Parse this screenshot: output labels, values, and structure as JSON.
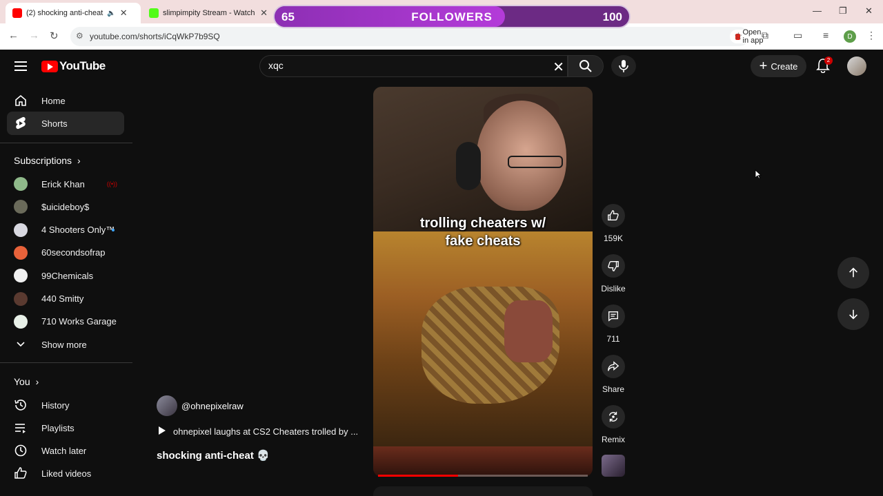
{
  "browser": {
    "tabs": [
      {
        "title": "(2) shocking anti-cheat",
        "active": true,
        "fav_color": "#ff0000"
      },
      {
        "title": "slimpimpity Stream - Watch Liv",
        "active": false,
        "fav_color": "#53fc18"
      }
    ],
    "url": "youtube.com/shorts/iCqWkP7b9SQ",
    "open_in_app": "Open in app",
    "profile_initial": "D"
  },
  "overlay": {
    "current": "65",
    "label": "FOLLOWERS",
    "max": "100",
    "progress_fraction": 0.65
  },
  "header": {
    "logo_text": "YouTube",
    "search_value": "xqc",
    "create_label": "Create",
    "notification_count": "2"
  },
  "sidebar": {
    "main": [
      {
        "label": "Home",
        "icon": "home-icon"
      },
      {
        "label": "Shorts",
        "icon": "shorts-icon",
        "active": true
      }
    ],
    "subscriptions_heading": "Subscriptions",
    "subscriptions": [
      {
        "label": "Erick Khan",
        "live": true,
        "color": "#8fb98a"
      },
      {
        "label": "$uicideboy$",
        "color": "#6a6a5a"
      },
      {
        "label": "4 Shooters Only™",
        "new": true,
        "color": "#d8d8e0"
      },
      {
        "label": "60secondsofrap",
        "color": "#e8623a"
      },
      {
        "label": "99Chemicals",
        "color": "#f0f0f0"
      },
      {
        "label": "440 Smitty",
        "color": "#5a3a30"
      },
      {
        "label": "710 Works Garage",
        "color": "#e8f0e8"
      }
    ],
    "show_more": "Show more",
    "you_heading": "You",
    "you_items": [
      {
        "label": "History",
        "icon": "history-icon"
      },
      {
        "label": "Playlists",
        "icon": "playlists-icon"
      },
      {
        "label": "Watch later",
        "icon": "watch-later-icon"
      },
      {
        "label": "Liked videos",
        "icon": "liked-videos-icon"
      }
    ]
  },
  "short": {
    "caption": "trolling cheaters w/ fake cheats",
    "channel": "@ohnepixelraw",
    "song": "ohnepixel laughs at CS2 Cheaters trolled by ...",
    "title": "shocking anti-cheat 💀",
    "progress_fraction": 0.38,
    "actions": {
      "likes": "159K",
      "dislike": "Dislike",
      "comments": "711",
      "share": "Share",
      "remix": "Remix"
    }
  }
}
